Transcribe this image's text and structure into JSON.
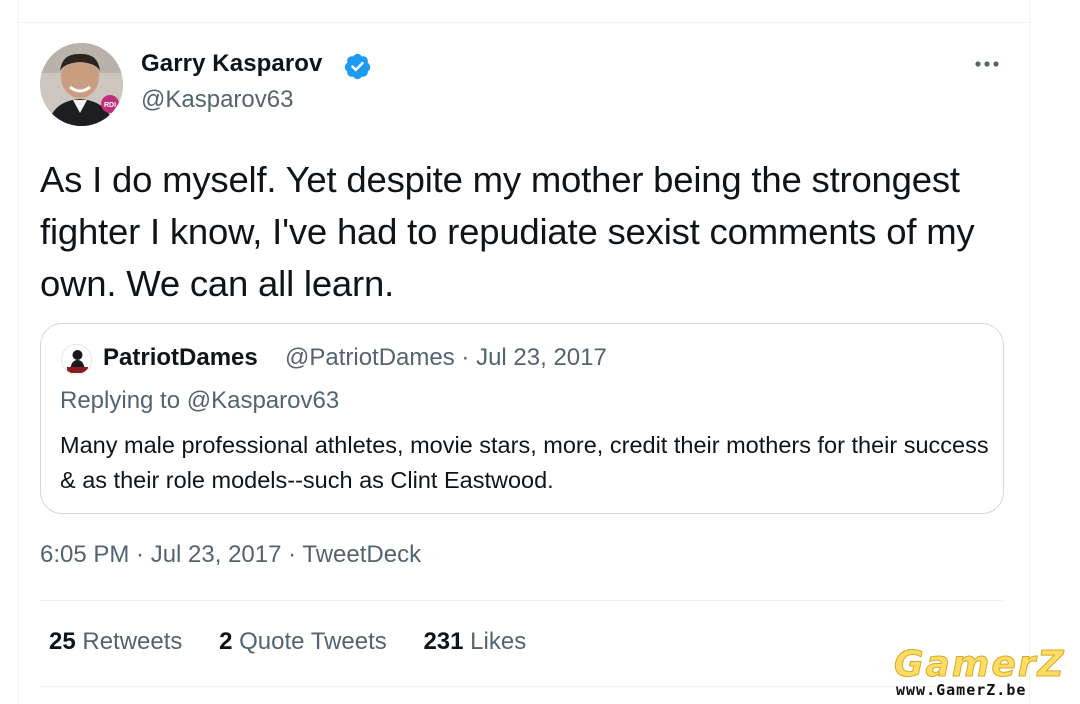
{
  "tweet": {
    "author": {
      "display_name": "Garry Kasparov",
      "handle": "@Kasparov63",
      "verified": true,
      "avatar_icon": "profile-photo",
      "avatar_badge_text": "RDI"
    },
    "more_icon": "more-horizontal-icon",
    "text": "As I do myself. Yet despite my mother being the strongest fighter I know, I've had to repudiate sexist comments of my own. We can all learn.",
    "quoted": {
      "display_name": "PatriotDames",
      "handle_date": "@PatriotDames · Jul 23, 2017",
      "replying_to": "Replying to @Kasparov63",
      "text": "Many male professional athletes, movie stars, more, credit their mothers for their success & as their role models--such as Clint Eastwood.",
      "avatar_icon": "profile-photo"
    },
    "meta": {
      "time_date": "6:05 PM · Jul 23, 2017",
      "separator": " · ",
      "source": "TweetDeck"
    },
    "stats": {
      "retweets_count": "25",
      "retweets_label": "Retweets",
      "quotes_count": "2",
      "quotes_label": "Quote Tweets",
      "likes_count": "231",
      "likes_label": "Likes"
    }
  },
  "watermark": {
    "logo": "GamerZ",
    "url": "www.GamerZ.be"
  },
  "colors": {
    "text": "#0f1419",
    "secondary": "#536471",
    "verified": "#1d9bf0",
    "border": "#cfd9de"
  }
}
